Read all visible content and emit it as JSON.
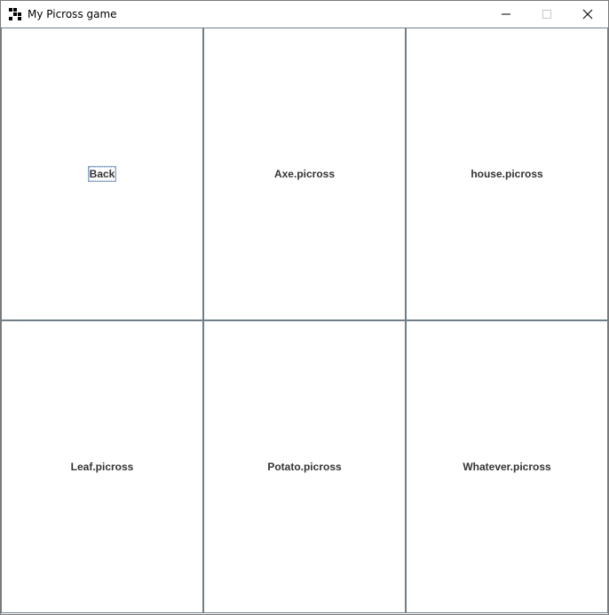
{
  "window": {
    "title": "My Picross game",
    "controls": {
      "minimize_icon": "minimize-icon",
      "maximize_icon": "maximize-icon",
      "close_icon": "close-icon"
    }
  },
  "grid": {
    "cells": [
      {
        "label": "Back",
        "focused": true
      },
      {
        "label": "Axe.picross"
      },
      {
        "label": "house.picross"
      },
      {
        "label": "Leaf.picross"
      },
      {
        "label": "Potato.picross"
      },
      {
        "label": "Whatever.picross"
      }
    ]
  },
  "colors": {
    "cell_border": "#6f7f8a",
    "label_text": "#333333",
    "focus_border": "#8aa8c8"
  }
}
